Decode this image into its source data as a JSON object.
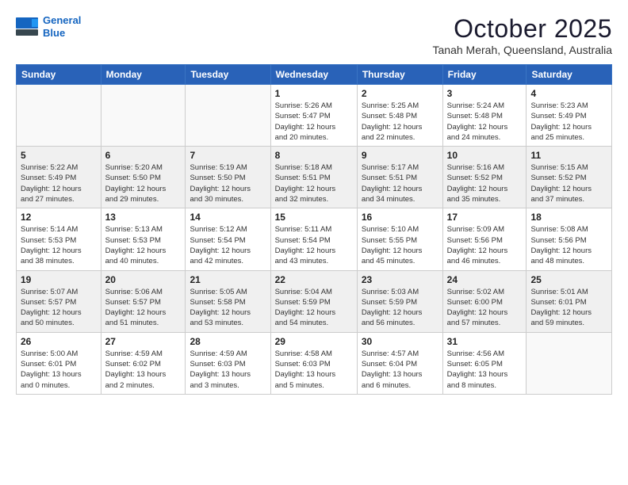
{
  "header": {
    "logo_line1": "General",
    "logo_line2": "Blue",
    "month_title": "October 2025",
    "location": "Tanah Merah, Queensland, Australia"
  },
  "weekdays": [
    "Sunday",
    "Monday",
    "Tuesday",
    "Wednesday",
    "Thursday",
    "Friday",
    "Saturday"
  ],
  "weeks": [
    [
      {
        "day": "",
        "info": ""
      },
      {
        "day": "",
        "info": ""
      },
      {
        "day": "",
        "info": ""
      },
      {
        "day": "1",
        "info": "Sunrise: 5:26 AM\nSunset: 5:47 PM\nDaylight: 12 hours\nand 20 minutes."
      },
      {
        "day": "2",
        "info": "Sunrise: 5:25 AM\nSunset: 5:48 PM\nDaylight: 12 hours\nand 22 minutes."
      },
      {
        "day": "3",
        "info": "Sunrise: 5:24 AM\nSunset: 5:48 PM\nDaylight: 12 hours\nand 24 minutes."
      },
      {
        "day": "4",
        "info": "Sunrise: 5:23 AM\nSunset: 5:49 PM\nDaylight: 12 hours\nand 25 minutes."
      }
    ],
    [
      {
        "day": "5",
        "info": "Sunrise: 5:22 AM\nSunset: 5:49 PM\nDaylight: 12 hours\nand 27 minutes."
      },
      {
        "day": "6",
        "info": "Sunrise: 5:20 AM\nSunset: 5:50 PM\nDaylight: 12 hours\nand 29 minutes."
      },
      {
        "day": "7",
        "info": "Sunrise: 5:19 AM\nSunset: 5:50 PM\nDaylight: 12 hours\nand 30 minutes."
      },
      {
        "day": "8",
        "info": "Sunrise: 5:18 AM\nSunset: 5:51 PM\nDaylight: 12 hours\nand 32 minutes."
      },
      {
        "day": "9",
        "info": "Sunrise: 5:17 AM\nSunset: 5:51 PM\nDaylight: 12 hours\nand 34 minutes."
      },
      {
        "day": "10",
        "info": "Sunrise: 5:16 AM\nSunset: 5:52 PM\nDaylight: 12 hours\nand 35 minutes."
      },
      {
        "day": "11",
        "info": "Sunrise: 5:15 AM\nSunset: 5:52 PM\nDaylight: 12 hours\nand 37 minutes."
      }
    ],
    [
      {
        "day": "12",
        "info": "Sunrise: 5:14 AM\nSunset: 5:53 PM\nDaylight: 12 hours\nand 38 minutes."
      },
      {
        "day": "13",
        "info": "Sunrise: 5:13 AM\nSunset: 5:53 PM\nDaylight: 12 hours\nand 40 minutes."
      },
      {
        "day": "14",
        "info": "Sunrise: 5:12 AM\nSunset: 5:54 PM\nDaylight: 12 hours\nand 42 minutes."
      },
      {
        "day": "15",
        "info": "Sunrise: 5:11 AM\nSunset: 5:54 PM\nDaylight: 12 hours\nand 43 minutes."
      },
      {
        "day": "16",
        "info": "Sunrise: 5:10 AM\nSunset: 5:55 PM\nDaylight: 12 hours\nand 45 minutes."
      },
      {
        "day": "17",
        "info": "Sunrise: 5:09 AM\nSunset: 5:56 PM\nDaylight: 12 hours\nand 46 minutes."
      },
      {
        "day": "18",
        "info": "Sunrise: 5:08 AM\nSunset: 5:56 PM\nDaylight: 12 hours\nand 48 minutes."
      }
    ],
    [
      {
        "day": "19",
        "info": "Sunrise: 5:07 AM\nSunset: 5:57 PM\nDaylight: 12 hours\nand 50 minutes."
      },
      {
        "day": "20",
        "info": "Sunrise: 5:06 AM\nSunset: 5:57 PM\nDaylight: 12 hours\nand 51 minutes."
      },
      {
        "day": "21",
        "info": "Sunrise: 5:05 AM\nSunset: 5:58 PM\nDaylight: 12 hours\nand 53 minutes."
      },
      {
        "day": "22",
        "info": "Sunrise: 5:04 AM\nSunset: 5:59 PM\nDaylight: 12 hours\nand 54 minutes."
      },
      {
        "day": "23",
        "info": "Sunrise: 5:03 AM\nSunset: 5:59 PM\nDaylight: 12 hours\nand 56 minutes."
      },
      {
        "day": "24",
        "info": "Sunrise: 5:02 AM\nSunset: 6:00 PM\nDaylight: 12 hours\nand 57 minutes."
      },
      {
        "day": "25",
        "info": "Sunrise: 5:01 AM\nSunset: 6:01 PM\nDaylight: 12 hours\nand 59 minutes."
      }
    ],
    [
      {
        "day": "26",
        "info": "Sunrise: 5:00 AM\nSunset: 6:01 PM\nDaylight: 13 hours\nand 0 minutes."
      },
      {
        "day": "27",
        "info": "Sunrise: 4:59 AM\nSunset: 6:02 PM\nDaylight: 13 hours\nand 2 minutes."
      },
      {
        "day": "28",
        "info": "Sunrise: 4:59 AM\nSunset: 6:03 PM\nDaylight: 13 hours\nand 3 minutes."
      },
      {
        "day": "29",
        "info": "Sunrise: 4:58 AM\nSunset: 6:03 PM\nDaylight: 13 hours\nand 5 minutes."
      },
      {
        "day": "30",
        "info": "Sunrise: 4:57 AM\nSunset: 6:04 PM\nDaylight: 13 hours\nand 6 minutes."
      },
      {
        "day": "31",
        "info": "Sunrise: 4:56 AM\nSunset: 6:05 PM\nDaylight: 13 hours\nand 8 minutes."
      },
      {
        "day": "",
        "info": ""
      }
    ]
  ]
}
